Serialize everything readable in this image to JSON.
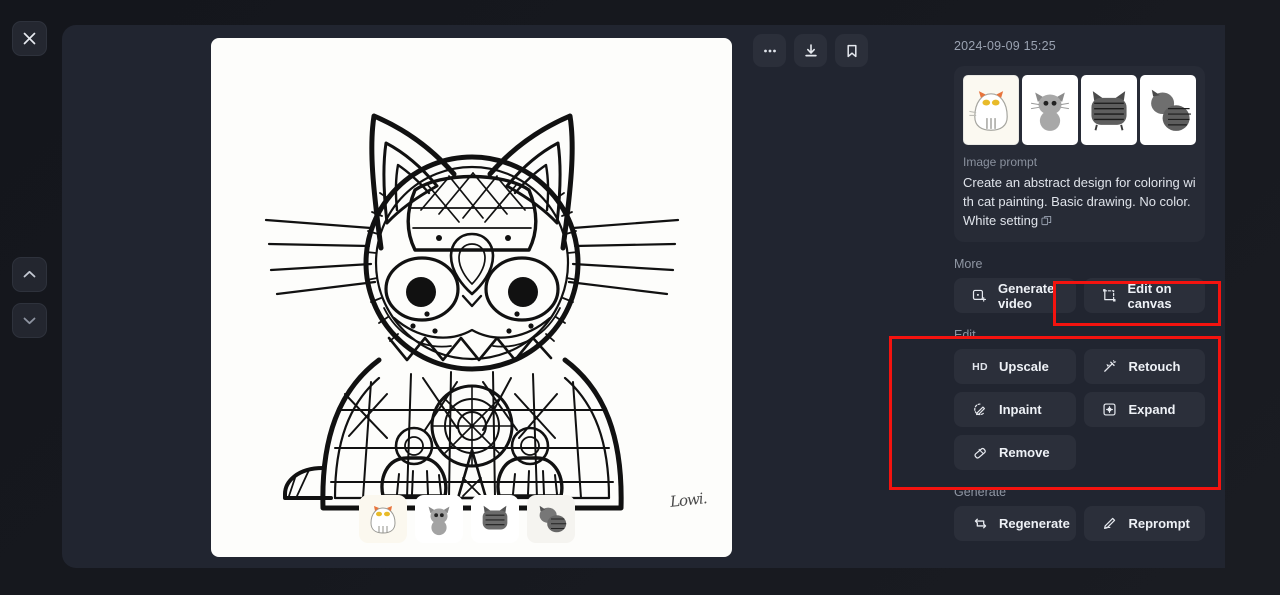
{
  "rail": {
    "close_label": "Close",
    "prev_label": "Previous image",
    "next_label": "Next image"
  },
  "viewer": {
    "tools": [
      {
        "name": "more-options",
        "label": "More options",
        "glyph": "…"
      },
      {
        "name": "download",
        "label": "Download",
        "glyph": "↓"
      },
      {
        "name": "bookmark",
        "label": "Bookmark",
        "glyph": "⚑"
      }
    ],
    "signature": "Lowi.",
    "filmstrip": [
      {
        "label": "Variation 1",
        "selected": true
      },
      {
        "label": "Variation 2",
        "selected": false
      },
      {
        "label": "Variation 3",
        "selected": false
      },
      {
        "label": "Variation 4",
        "selected": false
      }
    ]
  },
  "sidebar": {
    "timestamp": "2024-09-09 15:25",
    "prompt": {
      "thumbnails": [
        {
          "label": "Result 1",
          "selected": true
        },
        {
          "label": "Result 2",
          "selected": false
        },
        {
          "label": "Result 3",
          "selected": false
        },
        {
          "label": "Result 4",
          "selected": false
        }
      ],
      "label": "Image prompt",
      "text": "Create an abstract design for coloring with cat painting. Basic drawing. No color. White setting",
      "copy_icon": "copy-icon"
    },
    "sections": [
      {
        "name": "more",
        "title": "More",
        "buttons": [
          {
            "name": "generate-video",
            "label": "Generate video",
            "icon": "video-frame-icon"
          },
          {
            "name": "edit-on-canvas",
            "label": "Edit on canvas",
            "icon": "canvas-crop-icon"
          }
        ]
      },
      {
        "name": "edit",
        "title": "Edit",
        "buttons": [
          {
            "name": "upscale",
            "label": "Upscale",
            "icon": "hd-icon"
          },
          {
            "name": "retouch",
            "label": "Retouch",
            "icon": "magic-wand-icon"
          },
          {
            "name": "inpaint",
            "label": "Inpaint",
            "icon": "inpaint-brush-icon"
          },
          {
            "name": "expand",
            "label": "Expand",
            "icon": "expand-icon"
          },
          {
            "name": "remove",
            "label": "Remove",
            "icon": "eraser-icon"
          }
        ]
      },
      {
        "name": "generate",
        "title": "Generate",
        "buttons": [
          {
            "name": "regenerate",
            "label": "Regenerate",
            "icon": "refresh-icon"
          },
          {
            "name": "reprompt",
            "label": "Reprompt",
            "icon": "pencil-icon"
          }
        ]
      }
    ]
  },
  "highlights": [
    {
      "name": "edit-on-canvas-highlight",
      "color": "#f4130f"
    },
    {
      "name": "edit-section-highlight",
      "color": "#f4130f"
    }
  ]
}
